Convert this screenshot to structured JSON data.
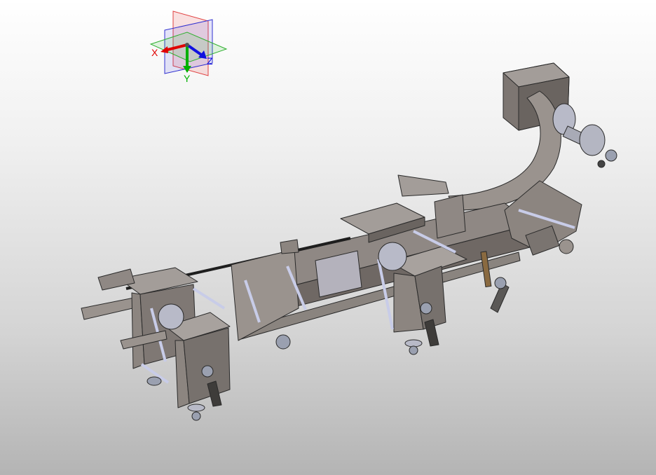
{
  "viewport": {
    "background_top": "#ffffff",
    "background_bottom": "#b4b4b4"
  },
  "triad": {
    "x_label": "X",
    "y_label": "Y",
    "z_label": "Z",
    "x_color": "#e00000",
    "y_color": "#00b000",
    "z_color": "#1010e0"
  },
  "model": {
    "icon": "cad-assembly-icon",
    "part_color": "#8c8580",
    "edge_color": "#2a2a2a",
    "rod_color": "#c8cce8"
  }
}
